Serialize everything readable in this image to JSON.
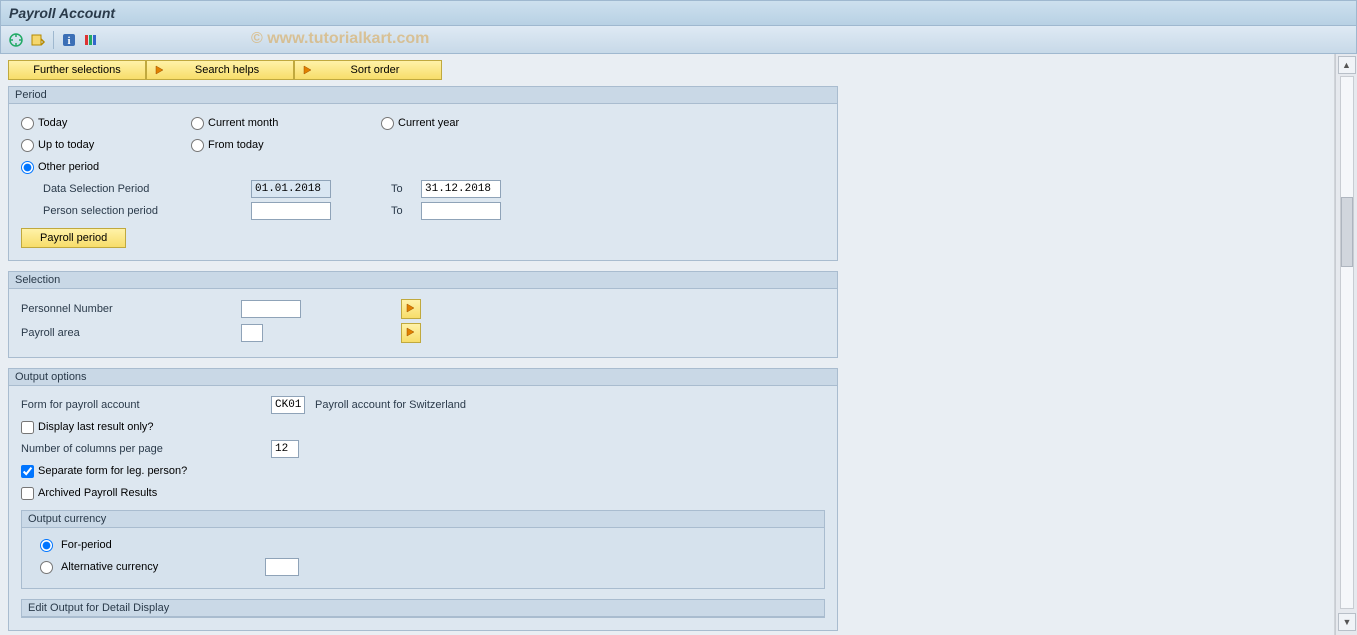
{
  "title": "Payroll Account",
  "watermark": "© www.tutorialkart.com",
  "toolbar_buttons": {
    "further_selections": "Further selections",
    "search_helps": "Search helps",
    "sort_order": "Sort order"
  },
  "period": {
    "title": "Period",
    "today": "Today",
    "current_month": "Current month",
    "current_year": "Current year",
    "up_to_today": "Up to today",
    "from_today": "From today",
    "other_period": "Other period",
    "data_selection_period": "Data Selection Period",
    "data_from": "01.01.2018",
    "data_to": "31.12.2018",
    "person_selection_period": "Person selection period",
    "person_from": "",
    "person_to": "",
    "to_label": "To",
    "payroll_period_btn": "Payroll period"
  },
  "selection": {
    "title": "Selection",
    "personnel_number": "Personnel Number",
    "personnel_number_val": "",
    "payroll_area": "Payroll area",
    "payroll_area_val": ""
  },
  "output": {
    "title": "Output options",
    "form_label": "Form for payroll account",
    "form_val": "CK01",
    "form_desc": "Payroll account for Switzerland",
    "display_last": "Display last result only?",
    "num_cols_label": "Number of columns per page",
    "num_cols_val": "12",
    "sep_form": "Separate form for leg. person?",
    "archived": "Archived Payroll Results",
    "currency": {
      "title": "Output currency",
      "for_period": "For-period",
      "alt_currency": "Alternative currency",
      "alt_val": ""
    },
    "edit_output": "Edit Output for Detail Display"
  }
}
